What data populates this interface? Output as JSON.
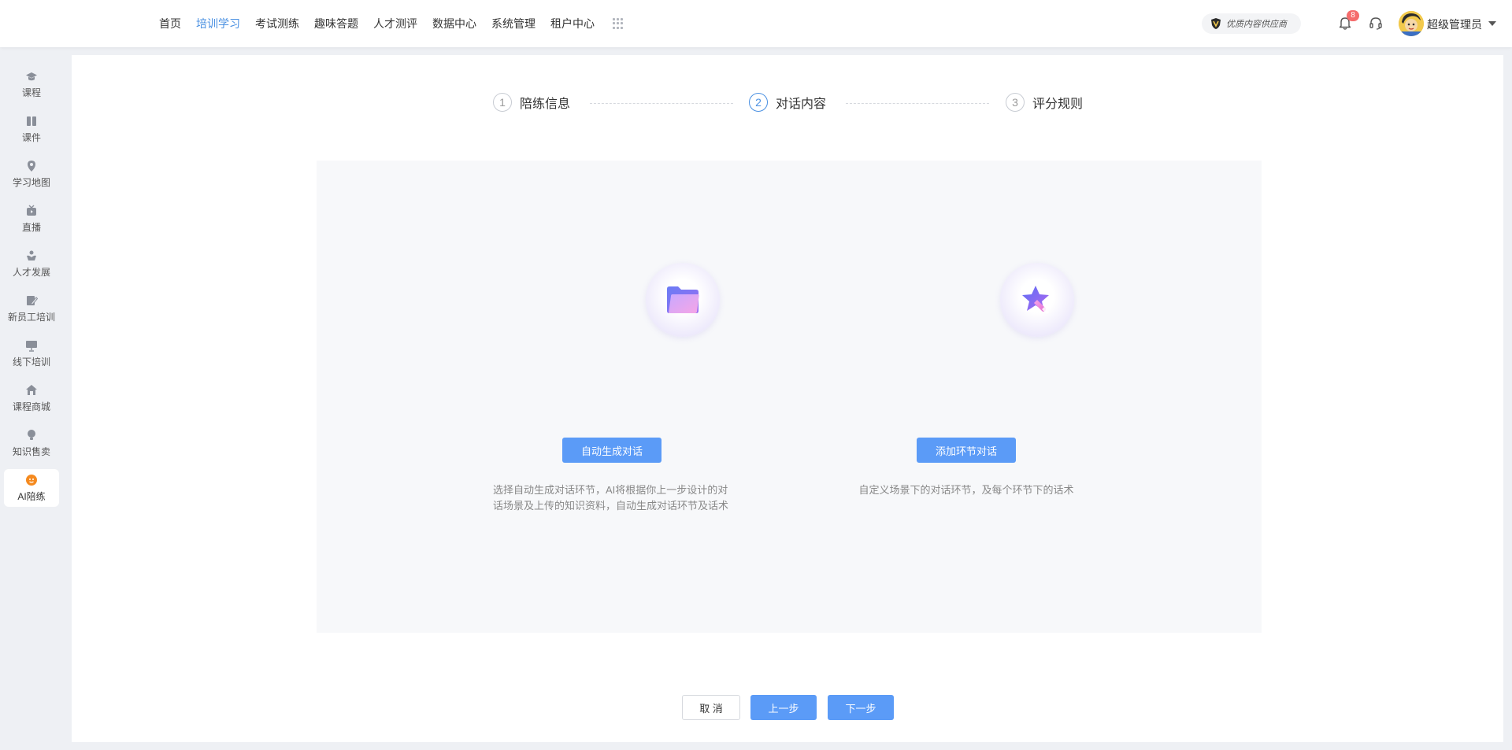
{
  "nav": {
    "items": [
      {
        "label": "首页",
        "active": false
      },
      {
        "label": "培训学习",
        "active": true
      },
      {
        "label": "考试测练",
        "active": false
      },
      {
        "label": "趣味答题",
        "active": false
      },
      {
        "label": "人才测评",
        "active": false
      },
      {
        "label": "数据中心",
        "active": false
      },
      {
        "label": "系统管理",
        "active": false
      },
      {
        "label": "租户中心",
        "active": false
      }
    ],
    "more_icon": "grid-icon"
  },
  "header": {
    "vendor_badge": "优质内容供应商",
    "notification_count": "8",
    "username": "超级管理员"
  },
  "sidebar": {
    "items": [
      {
        "label": "课程",
        "icon": "graduation-cap-icon",
        "active": false
      },
      {
        "label": "课件",
        "icon": "book-icon",
        "active": false
      },
      {
        "label": "学习地图",
        "icon": "map-pin-icon",
        "active": false
      },
      {
        "label": "直播",
        "icon": "live-icon",
        "active": false
      },
      {
        "label": "人才发展",
        "icon": "talent-icon",
        "active": false
      },
      {
        "label": "新员工培训",
        "icon": "edit-icon",
        "active": false
      },
      {
        "label": "线下培训",
        "icon": "presentation-icon",
        "active": false
      },
      {
        "label": "课程商城",
        "icon": "store-icon",
        "active": false
      },
      {
        "label": "知识售卖",
        "icon": "lightbulb-icon",
        "active": false
      },
      {
        "label": "AI陪练",
        "icon": "ai-coach-icon",
        "active": true
      }
    ]
  },
  "steps": [
    {
      "num": "1",
      "title": "陪练信息",
      "active": false
    },
    {
      "num": "2",
      "title": "对话内容",
      "active": true
    },
    {
      "num": "3",
      "title": "评分规则",
      "active": false
    }
  ],
  "options": {
    "auto": {
      "button": "自动生成对话",
      "desc": "选择自动生成对话环节，AI将根据你上一步设计的对话场景及上传的知识资料，自动生成对话环节及话术"
    },
    "manual": {
      "button": "添加环节对话",
      "desc": "自定义场景下的对话环节，及每个环节下的话术"
    }
  },
  "footer": {
    "cancel": "取 消",
    "prev": "上一步",
    "next": "下一步"
  },
  "colors": {
    "accent": "#4a90e2",
    "primary_button": "#5b9bf7",
    "badge": "#f56c6c"
  }
}
